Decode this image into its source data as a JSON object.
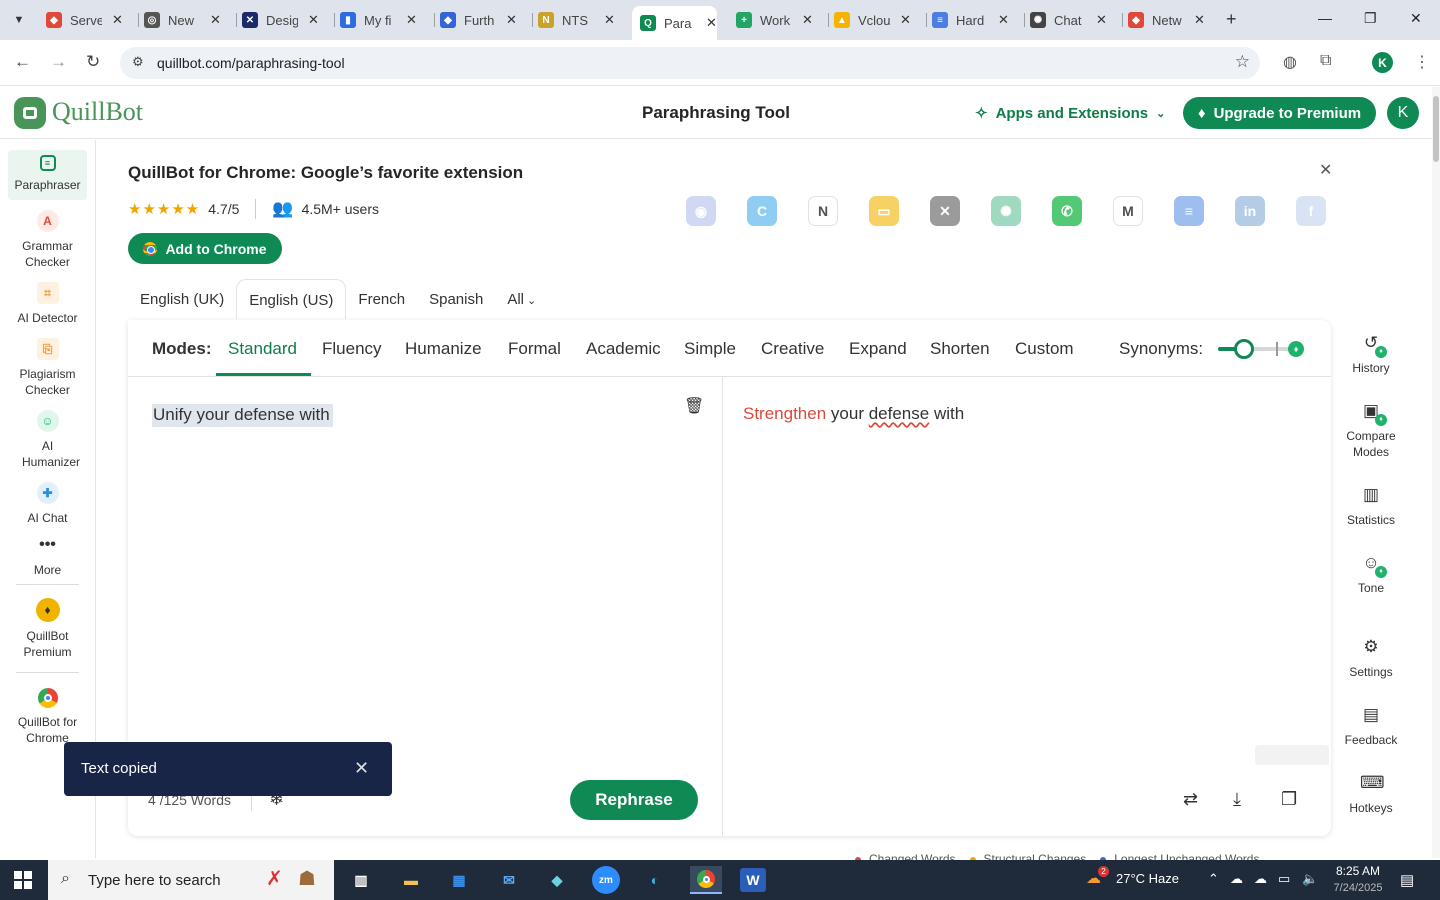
{
  "browser": {
    "tabs": [
      {
        "title": "Serve",
        "favicon_color": "#e0493a",
        "favicon_glyph": "◆"
      },
      {
        "title": "New",
        "favicon_color": "#555555",
        "favicon_glyph": "◎"
      },
      {
        "title": "Desig",
        "favicon_color": "#1b2a6b",
        "favicon_glyph": "✕"
      },
      {
        "title": "My fi",
        "favicon_color": "#2d6cdf",
        "favicon_glyph": "▮"
      },
      {
        "title": "Furth",
        "favicon_color": "#3465d8",
        "favicon_glyph": "◆"
      },
      {
        "title": "NTS",
        "favicon_color": "#c9a227",
        "favicon_glyph": "N"
      },
      {
        "title": "Para",
        "favicon_color": "#0f8a55",
        "favicon_glyph": "Q"
      },
      {
        "title": "Work",
        "favicon_color": "#23a566",
        "favicon_glyph": "+"
      },
      {
        "title": "Vclou",
        "favicon_color": "#f4b400",
        "favicon_glyph": "▲"
      },
      {
        "title": "Hard",
        "favicon_color": "#4a7ee0",
        "favicon_glyph": "≡"
      },
      {
        "title": "Chat",
        "favicon_color": "#444444",
        "favicon_glyph": "✺"
      },
      {
        "title": "Netw",
        "favicon_color": "#e0493a",
        "favicon_glyph": "◆"
      }
    ],
    "active_tab_index": 6,
    "url": "quillbot.com/paraphrasing-tool",
    "profile_initial": "K"
  },
  "header": {
    "logo_text": "QuillBot",
    "page_title": "Paraphrasing Tool",
    "apps_label": "Apps and Extensions",
    "upgrade_label": "Upgrade to Premium",
    "avatar_initial": "K"
  },
  "sidebar": {
    "items": [
      {
        "label": "Paraphraser",
        "icon": "paraphraser-icon",
        "color": "#0f8a55"
      },
      {
        "label": "Grammar Checker",
        "icon": "grammar-icon",
        "color": "#e0493a"
      },
      {
        "label": "AI Detector",
        "icon": "ai-detector-icon",
        "color": "#f29b38"
      },
      {
        "label": "Plagiarism Checker",
        "icon": "plagiarism-icon",
        "color": "#f29b38"
      },
      {
        "label": "AI Humanizer",
        "icon": "humanizer-icon",
        "color": "#1fb26b"
      },
      {
        "label": "AI Chat",
        "icon": "chat-icon",
        "color": "#2b8ee0"
      },
      {
        "label": "More",
        "icon": "more-icon",
        "color": "#333333"
      },
      {
        "label": "QuillBot Premium",
        "icon": "premium-icon",
        "color": "#f0b400"
      },
      {
        "label": "QuillBot for Chrome",
        "icon": "chrome-icon",
        "color": "#ea4335"
      }
    ]
  },
  "promo": {
    "title": "QuillBot for Chrome: Google’s favorite extension",
    "rating": "4.7/5",
    "users": "4.5M+ users",
    "cta": "Add to Chrome",
    "apps": [
      {
        "name": "discord-icon",
        "color": "#c9d2f3",
        "glyph": "◉"
      },
      {
        "name": "canva-icon",
        "color": "#7cc6f0",
        "glyph": "C"
      },
      {
        "name": "notion-icon",
        "color": "#ffffff",
        "glyph": "N"
      },
      {
        "name": "slides-icon",
        "color": "#f6c94a",
        "glyph": "▭"
      },
      {
        "name": "x-icon",
        "color": "#8a8a8a",
        "glyph": "✕"
      },
      {
        "name": "chatgpt-icon",
        "color": "#8fd3b5",
        "glyph": "✺"
      },
      {
        "name": "whatsapp-icon",
        "color": "#37c05e",
        "glyph": "✆"
      },
      {
        "name": "gmail-icon",
        "color": "#ffffff",
        "glyph": "M"
      },
      {
        "name": "docs-icon",
        "color": "#8fb3ee",
        "glyph": "≡"
      },
      {
        "name": "linkedin-icon",
        "color": "#a9c4e2",
        "glyph": "in"
      },
      {
        "name": "facebook-icon",
        "color": "#d4dff2",
        "glyph": "f"
      }
    ]
  },
  "languages": {
    "tabs": [
      "English (UK)",
      "English (US)",
      "French",
      "Spanish",
      "All"
    ],
    "active_index": 1
  },
  "modes": {
    "label": "Modes:",
    "items": [
      "Standard",
      "Fluency",
      "Humanize",
      "Formal",
      "Academic",
      "Simple",
      "Creative",
      "Expand",
      "Shorten",
      "Custom"
    ],
    "active_index": 0,
    "synonyms_label": "Synonyms:",
    "synonyms_level": 0.33
  },
  "editor": {
    "input_text": "Unify your defense with",
    "output_changed": "Strengthen",
    "output_middle": " your ",
    "output_flagged": "defense",
    "output_rest": " with",
    "word_count": "4 /125 Words",
    "rephrase_label": "Rephrase"
  },
  "right_tools": [
    {
      "label": "History",
      "icon": "history-icon",
      "premium": true
    },
    {
      "label": "Compare Modes",
      "icon": "compare-modes-icon",
      "premium": true
    },
    {
      "label": "Statistics",
      "icon": "statistics-icon",
      "premium": false
    },
    {
      "label": "Tone",
      "icon": "tone-icon",
      "premium": true
    },
    {
      "label": "Settings",
      "icon": "settings-icon",
      "premium": false
    },
    {
      "label": "Feedback",
      "icon": "feedback-icon",
      "premium": false
    },
    {
      "label": "Hotkeys",
      "icon": "hotkeys-icon",
      "premium": false
    }
  ],
  "legend": {
    "items": [
      {
        "label": "Changed Words",
        "color": "#d94a3b"
      },
      {
        "label": "Structural Changes",
        "color": "#f0a400"
      },
      {
        "label": "Longest Unchanged Words",
        "color": "#2b6fd6"
      }
    ]
  },
  "toast": {
    "message": "Text copied"
  },
  "taskbar": {
    "search_placeholder": "Type here to search",
    "weather": "27°C  Haze",
    "time": "8:25 AM",
    "date": "7/24/2025",
    "weather_badge": "2"
  }
}
